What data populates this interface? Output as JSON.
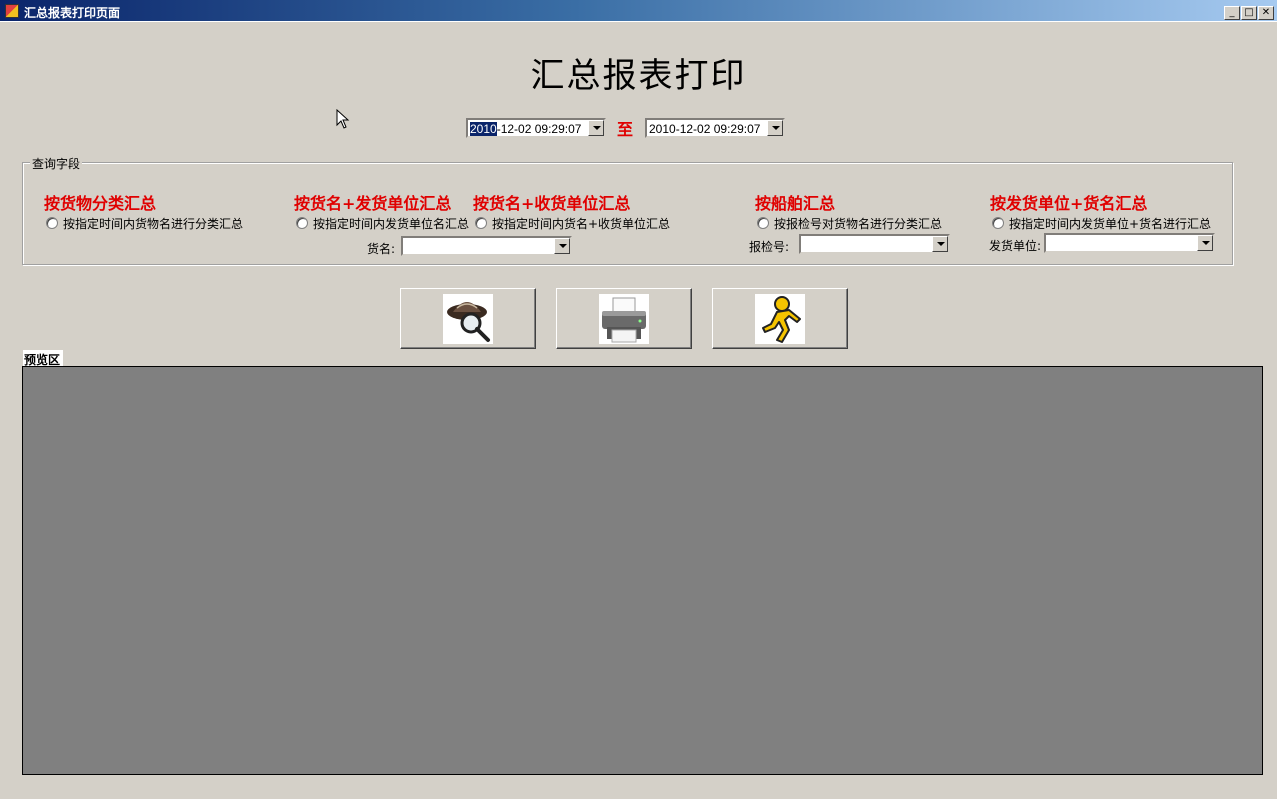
{
  "window": {
    "title": "汇总报表打印页面",
    "minimize_label": "_",
    "maximize_label": "□",
    "close_label": "✕"
  },
  "main_title": "汇总报表打印",
  "date_range": {
    "start_selected": "2010",
    "start_rest": "-12-02 09:29:07",
    "separator": "至",
    "end_value": "2010-12-02 09:29:07"
  },
  "query_group": {
    "legend": "查询字段",
    "sections": [
      {
        "title": "按货物分类汇总",
        "radio_label": "按指定时间内货物名进行分类汇总"
      },
      {
        "title": "按货名+发货单位汇总",
        "radio_label": "按指定时间内发货单位名汇总"
      },
      {
        "title": "按货名+收货单位汇总",
        "radio_label": "按指定时间内货名+收货单位汇总"
      },
      {
        "title": "按船舶汇总",
        "radio_label": "按报检号对货物名进行分类汇总"
      },
      {
        "title": "按发货单位+货名汇总",
        "radio_label": "按指定时间内发货单位+货名进行汇总"
      }
    ],
    "goods_name_label": "货名:",
    "inspection_no_label": "报检号:",
    "shipper_label": "发货单位:"
  },
  "actions": {
    "search_icon": "detective-magnifier-icon",
    "print_icon": "printer-icon",
    "exit_icon": "running-man-icon"
  },
  "preview": {
    "label": "预览区",
    "background_color": "#808080"
  },
  "colors": {
    "accent_red": "#e00000",
    "title_bar": "#0a246a",
    "window_bg": "#d4d0c8"
  }
}
